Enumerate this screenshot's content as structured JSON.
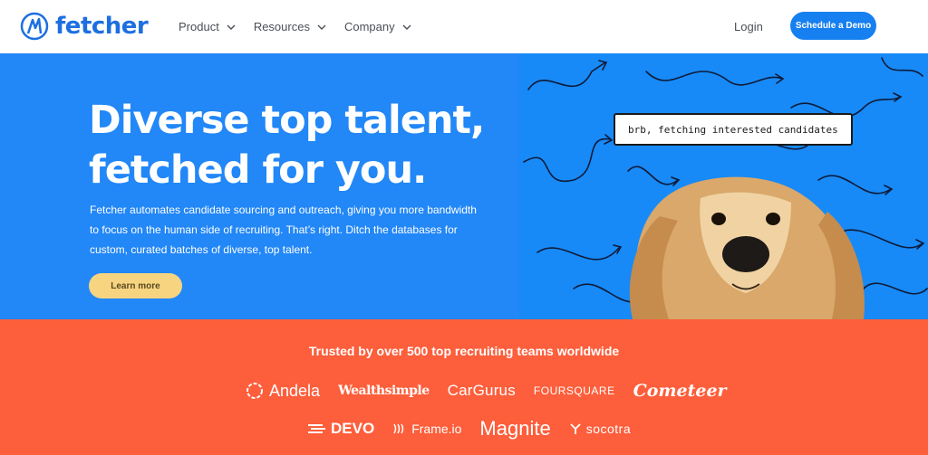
{
  "nav": {
    "logo_text": "fetcher",
    "menu": [
      {
        "label": "Product"
      },
      {
        "label": "Resources"
      },
      {
        "label": "Company"
      }
    ],
    "login_label": "Login",
    "demo_label": "Schedule a Demo"
  },
  "hero": {
    "title_line1": "Diverse top talent,",
    "title_line2": "fetched for you.",
    "description": "Fetcher automates candidate sourcing and outreach, giving you more bandwidth to focus on the human side of recruiting. That’s right. Ditch the databases for custom, curated batches of diverse, top talent.",
    "cta_label": "Learn more",
    "speech_bubble": "brb, fetching interested candidates"
  },
  "trust": {
    "title": "Trusted by over 500 top recruiting teams worldwide",
    "logos_row1": [
      "Andela",
      "Wealthsimple",
      "CarGurus",
      "FOURSQUARE",
      "Cometeer"
    ],
    "logos_row2": [
      "DEVO",
      "Frame.io",
      "Magnite",
      "socotra"
    ]
  },
  "colors": {
    "brand_blue": "#1d6fe0",
    "hero_blue": "#2287f7",
    "demo_button": "#1780f0",
    "cta_yellow": "#f7d480",
    "trust_orange": "#fd5e3b"
  }
}
